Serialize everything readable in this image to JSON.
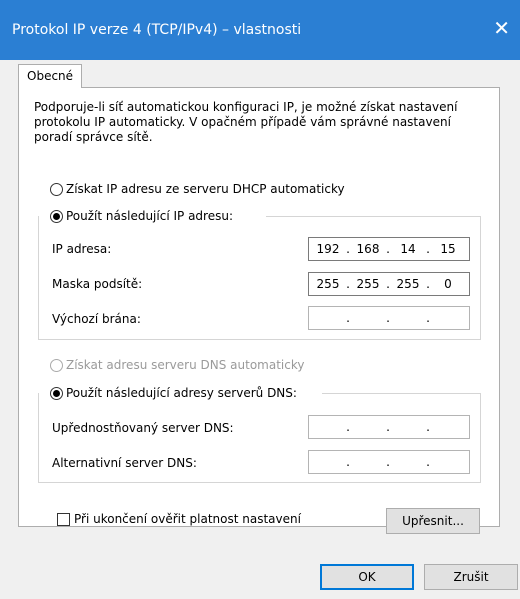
{
  "window": {
    "title": "Protokol IP verze 4 (TCP/IPv4) – vlastnosti",
    "close_glyph": "✕"
  },
  "tabs": [
    {
      "label": "Obecné"
    }
  ],
  "description": "Podporuje-li síť automatickou konfiguraci IP, je možné získat nastavení protokolu IP automaticky. V opačném případě vám správné nastavení poradí správce sítě.",
  "ip_section": {
    "auto_option": {
      "label": "Získat IP adresu ze serveru DHCP automaticky",
      "selected": false
    },
    "manual_option": {
      "label": "Použít následující IP adresu:",
      "selected": true
    },
    "fields": [
      {
        "label": "IP adresa:",
        "octets": [
          "192",
          "168",
          "14",
          "15"
        ]
      },
      {
        "label": "Maska podsítě:",
        "octets": [
          "255",
          "255",
          "255",
          "0"
        ]
      },
      {
        "label": "Výchozí brána:",
        "octets": [
          "",
          "",
          "",
          ""
        ]
      }
    ]
  },
  "dns_section": {
    "auto_option": {
      "label": "Získat adresu serveru DNS automaticky",
      "selected": false,
      "disabled": true
    },
    "manual_option": {
      "label": "Použít následující adresy serverů DNS:",
      "selected": true
    },
    "fields": [
      {
        "label": "Upřednostňovaný server DNS:",
        "octets": [
          "",
          "",
          "",
          ""
        ]
      },
      {
        "label": "Alternativní server DNS:",
        "octets": [
          "",
          "",
          "",
          ""
        ]
      }
    ]
  },
  "validate_checkbox": {
    "label": "Při ukončení ověřit platnost nastavení",
    "checked": false
  },
  "buttons": {
    "advanced": "Upřesnit...",
    "ok": "OK",
    "cancel": "Zrušit"
  },
  "colors": {
    "titlebar": "#2b7fd3",
    "default_button_border": "#0078d7"
  }
}
